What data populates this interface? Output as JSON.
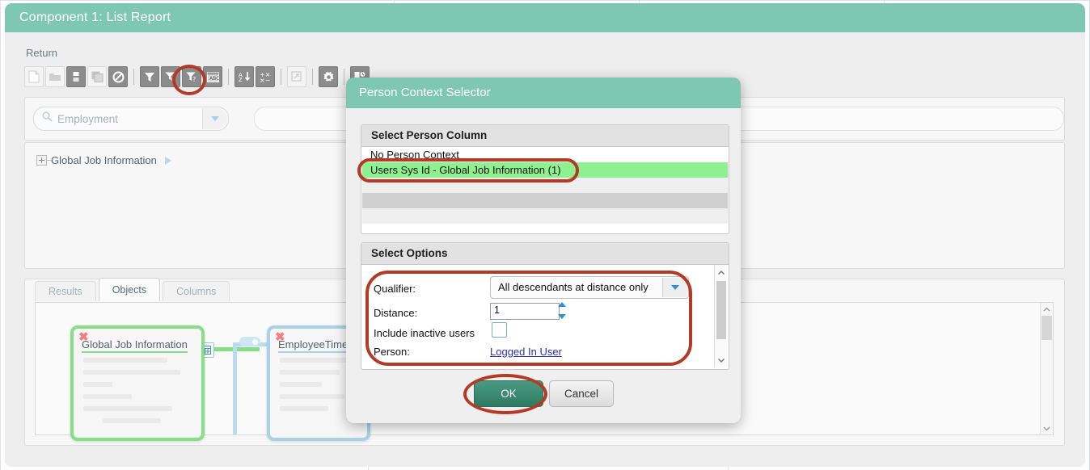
{
  "window": {
    "title": "Component 1: List Report"
  },
  "toolbar": {
    "return_label": "Return",
    "buttons": [
      {
        "name": "new-document-icon",
        "glyph": "page"
      },
      {
        "name": "open-folder-icon",
        "glyph": "folder"
      },
      {
        "name": "save-icon",
        "glyph": "save"
      },
      {
        "name": "save-as-icon",
        "glyph": "save-as"
      },
      {
        "name": "cancel-block-icon",
        "glyph": "block"
      },
      {
        "name": "filter-icon",
        "glyph": "funnel"
      },
      {
        "name": "filter-settings-icon",
        "glyph": "funnel-gear"
      },
      {
        "name": "filter-prompt-icon",
        "glyph": "funnel-question"
      },
      {
        "name": "parameters-icon",
        "glyph": "param"
      },
      {
        "name": "sort-az-icon",
        "glyph": "sort"
      },
      {
        "name": "calculation-icon",
        "glyph": "calc"
      },
      {
        "name": "export-icon",
        "glyph": "export"
      },
      {
        "name": "settings-gear-icon",
        "glyph": "gear"
      },
      {
        "name": "schedule-icon",
        "glyph": "schedule"
      }
    ]
  },
  "search": {
    "placeholder": "Employment",
    "icon": "search-icon"
  },
  "tree": {
    "node_label": "Global Job Information",
    "expander": "plus-icon",
    "arrow": "play-arrow-icon"
  },
  "tabs": [
    {
      "label": "Results",
      "active": false
    },
    {
      "label": "Objects",
      "active": true
    },
    {
      "label": "Columns",
      "active": false
    }
  ],
  "diagram": {
    "entities": [
      {
        "title": "Global Job Information",
        "color": "#86de86",
        "close_icon": "close-x-icon"
      },
      {
        "title": "EmployeeTime",
        "color": "#a9d2e8",
        "close_icon": "close-x-icon"
      }
    ],
    "join_icon": "join-grid-icon",
    "link_toggle_icon": "link-toggle-icon"
  },
  "modal": {
    "title": "Person Context Selector",
    "person_column": {
      "header": "Select Person Column",
      "items": [
        {
          "label": "No Person Context",
          "selected": false
        },
        {
          "label": "Users Sys Id - Global Job Information (1)",
          "selected": true
        },
        {
          "label": "",
          "selected": false
        },
        {
          "label": "",
          "selected": false
        },
        {
          "label": "",
          "selected": false
        }
      ]
    },
    "options": {
      "header": "Select Options",
      "qualifier_label": "Qualifier:",
      "qualifier_value": "All descendants at distance only",
      "distance_label": "Distance:",
      "distance_value": "1",
      "include_inactive_label": "Include inactive users",
      "include_inactive_checked": false,
      "person_label": "Person:",
      "person_value": "Logged In User"
    },
    "buttons": {
      "ok": "OK",
      "cancel": "Cancel"
    }
  },
  "colors": {
    "header_teal": "#7ec8b1",
    "selection_green": "#8ef08e",
    "annotation_red": "#b33a26",
    "ok_button_green": "#2f7b62",
    "link_blue": "#2b32b2"
  }
}
